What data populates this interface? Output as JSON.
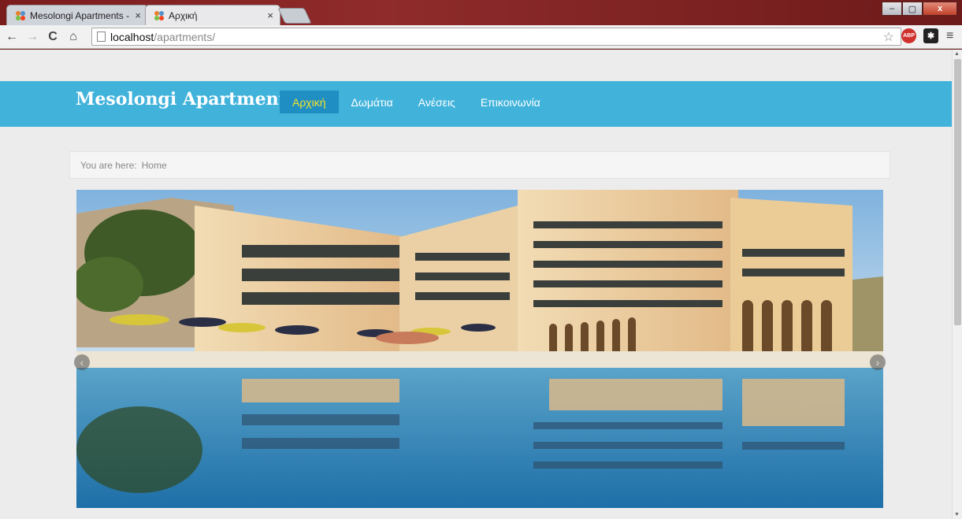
{
  "browser": {
    "tabs": [
      {
        "title": "Mesolongi Apartments - A",
        "active": false
      },
      {
        "title": "Αρχική",
        "active": true
      }
    ],
    "tab_close_glyph": "×",
    "url_host": "localhost",
    "url_path": "/apartments/",
    "extensions": [
      "ABP",
      "✱"
    ],
    "window_buttons": [
      "–",
      "▢",
      "x"
    ]
  },
  "site": {
    "brand": "Mesolongi Apartments",
    "menu": [
      "Αρχική",
      "Δωμάτια",
      "Ανέσεις",
      "Επικοινωνία"
    ],
    "active_menu": "Αρχική",
    "breadcrumb_label": "You are here:",
    "breadcrumb_current": "Home"
  },
  "colors": {
    "header_bg": "#41b3db",
    "active_menu_bg": "#1f8ec3",
    "active_menu_text": "#f3e22b",
    "page_bg": "#ececec",
    "titlebar": "#7b1c1c"
  },
  "icons": {
    "back": "back-arrow-icon",
    "forward": "forward-arrow-icon",
    "reload": "reload-icon",
    "home": "home-icon",
    "bookmark": "star-icon",
    "menu": "hamburger-menu-icon",
    "slider_prev": "chevron-left-icon",
    "slider_next": "chevron-right-icon"
  }
}
